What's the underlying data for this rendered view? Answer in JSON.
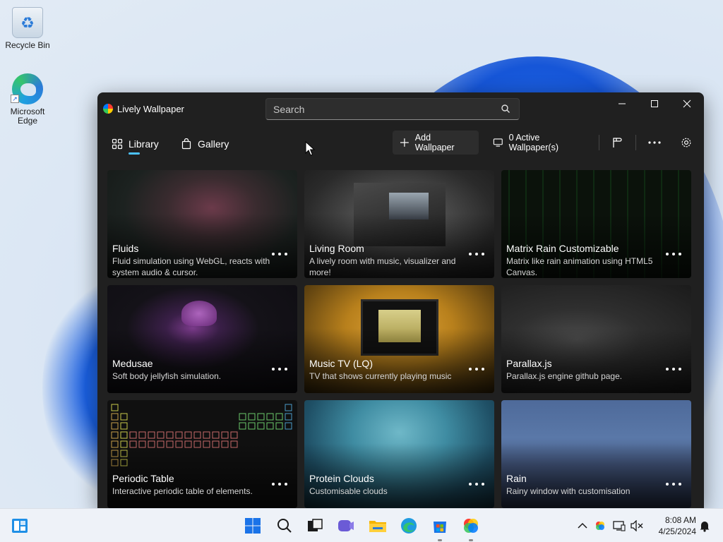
{
  "desktop": {
    "icons": [
      {
        "label": "Recycle Bin"
      },
      {
        "label": "Microsoft Edge"
      }
    ]
  },
  "window": {
    "title": "Lively Wallpaper",
    "search": {
      "placeholder": "Search"
    },
    "nav": {
      "library_label": "Library",
      "gallery_label": "Gallery"
    },
    "toolbar": {
      "add_label": "Add Wallpaper",
      "active_label": "0 Active Wallpaper(s)"
    },
    "cards": [
      {
        "title": "Fluids",
        "desc": "Fluid simulation using WebGL, reacts with system audio & cursor."
      },
      {
        "title": "Living Room",
        "desc": "A lively room with music, visualizer and more!"
      },
      {
        "title": "Matrix Rain Customizable",
        "desc": "Matrix like rain animation using HTML5 Canvas."
      },
      {
        "title": "Medusae",
        "desc": "Soft body jellyfish simulation."
      },
      {
        "title": "Music TV (LQ)",
        "desc": "TV that shows currently playing music"
      },
      {
        "title": "Parallax.js",
        "desc": "Parallax.js engine github page."
      },
      {
        "title": "Periodic Table",
        "desc": "Interactive periodic table of elements."
      },
      {
        "title": "Protein Clouds",
        "desc": "Customisable clouds"
      },
      {
        "title": "Rain",
        "desc": "Rainy window with customisation"
      }
    ]
  },
  "taskbar": {
    "clock_time": "8:08 AM",
    "clock_date": "4/25/2024",
    "pinned": [
      "start-icon",
      "search-icon",
      "task-view-icon",
      "meet-icon",
      "file-explorer-icon",
      "edge-icon",
      "store-icon",
      "lively-icon"
    ]
  },
  "colors": {
    "accent": "#4cc2ff",
    "window_bg": "#202020",
    "taskbar_bg": "#eef2f8"
  }
}
